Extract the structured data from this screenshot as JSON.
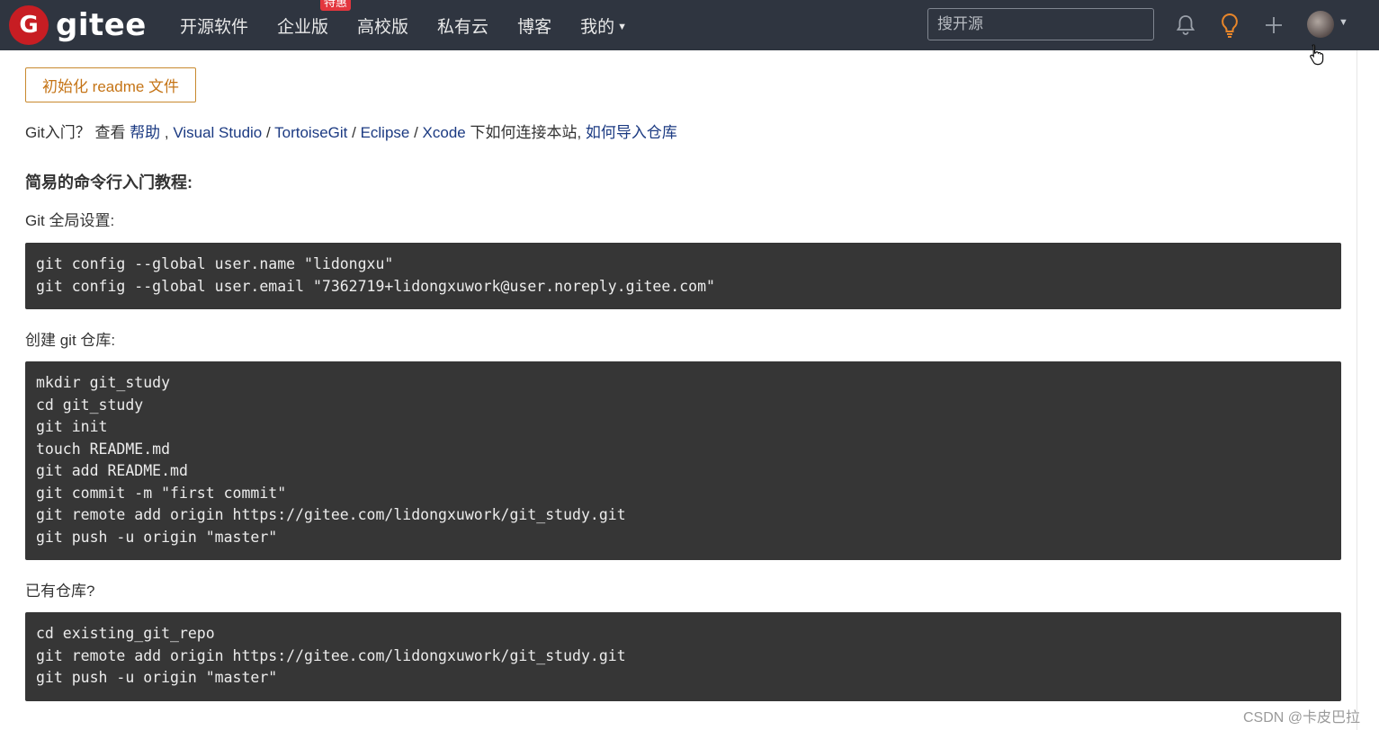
{
  "nav": {
    "logo_letter": "G",
    "logo_text": "gitee",
    "items": [
      {
        "label": "开源软件"
      },
      {
        "label": "企业版",
        "badge": "特惠"
      },
      {
        "label": "高校版"
      },
      {
        "label": "私有云"
      },
      {
        "label": "博客"
      },
      {
        "label": "我的"
      }
    ],
    "search_placeholder": "搜开源",
    "icons": [
      "bell-icon",
      "lightbulb-icon",
      "plus-icon",
      "avatar"
    ]
  },
  "init_button": "初始化 readme 文件",
  "help": {
    "prefix": "Git入门？ 查看 ",
    "help_link": "帮助",
    "sep1": " , ",
    "vs_link": "Visual Studio",
    "sep2": " / ",
    "tortoise_link": "TortoiseGit",
    "sep3": " / ",
    "eclipse_link": "Eclipse",
    "sep4": " / ",
    "xcode_link": "Xcode",
    "mid": " 下如何连接本站, ",
    "import_link": "如何导入仓库"
  },
  "tutorial_title": "简易的命令行入门教程:",
  "sections": {
    "global": {
      "label": "Git 全局设置:",
      "lines": [
        "git config --global user.name \"lidongxu\"",
        "git config --global user.email \"7362719+lidongxuwork@user.noreply.gitee.com\""
      ]
    },
    "create": {
      "label": "创建 git 仓库:",
      "lines": [
        "mkdir git_study",
        "cd git_study",
        "git init",
        "touch README.md",
        "git add README.md",
        "git commit -m \"first commit\"",
        "git remote add origin https://gitee.com/lidongxuwork/git_study.git",
        "git push -u origin \"master\""
      ]
    },
    "existing": {
      "label": "已有仓库?",
      "lines": [
        "cd existing_git_repo",
        "git remote add origin https://gitee.com/lidongxuwork/git_study.git",
        "git push -u origin \"master\""
      ]
    }
  },
  "watermark": "CSDN @卡皮巴拉",
  "colors": {
    "topbar": "#2f3540",
    "logo_red": "#c71d23",
    "badge_red": "#e3363e",
    "code_bg": "#363636",
    "link": "#1b3a82",
    "init_button_border": "#c8892e",
    "lightbulb": "#e8862a"
  }
}
